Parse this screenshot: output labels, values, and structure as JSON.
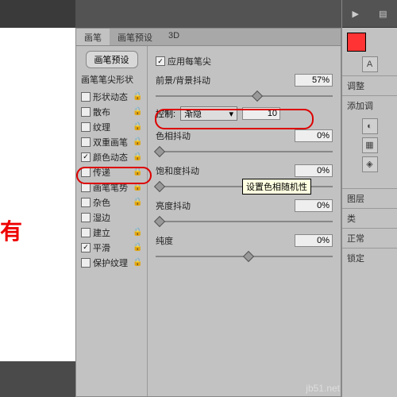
{
  "tabs": {
    "brush": "画笔",
    "preset": "画笔预设",
    "three_d": "3D"
  },
  "sidebar": {
    "preset_btn": "画笔预设",
    "section_title": "画笔笔尖形状",
    "items": [
      {
        "label": "形状动态",
        "checked": false,
        "locked": true
      },
      {
        "label": "散布",
        "checked": false,
        "locked": true
      },
      {
        "label": "纹理",
        "checked": false,
        "locked": true
      },
      {
        "label": "双重画笔",
        "checked": false,
        "locked": true
      },
      {
        "label": "颜色动态",
        "checked": true,
        "locked": true
      },
      {
        "label": "传递",
        "checked": false,
        "locked": true
      },
      {
        "label": "画笔笔势",
        "checked": false,
        "locked": true
      },
      {
        "label": "杂色",
        "checked": false,
        "locked": true
      },
      {
        "label": "湿边",
        "checked": false,
        "locked": false
      },
      {
        "label": "建立",
        "checked": false,
        "locked": true
      },
      {
        "label": "平滑",
        "checked": true,
        "locked": true
      },
      {
        "label": "保护纹理",
        "checked": false,
        "locked": true
      }
    ]
  },
  "main": {
    "apply_per_tip": "应用每笔尖",
    "fg_bg_jitter": "前景/背景抖动",
    "fg_bg_val": "57%",
    "control_label": "控制:",
    "control_value": "渐隐",
    "control_num": "10",
    "hue_jitter": "色相抖动",
    "sat_jitter": "饱和度抖动",
    "bright_jitter": "亮度抖动",
    "purity": "纯度",
    "zero": "0%"
  },
  "tooltip": "设置色相随机性",
  "right": {
    "adjust": "调整",
    "add_adj": "添加调",
    "layers": "图层",
    "kind": "类",
    "normal": "正常",
    "lock": "锁定"
  },
  "watermark": "jb51.net",
  "red_char": "有"
}
